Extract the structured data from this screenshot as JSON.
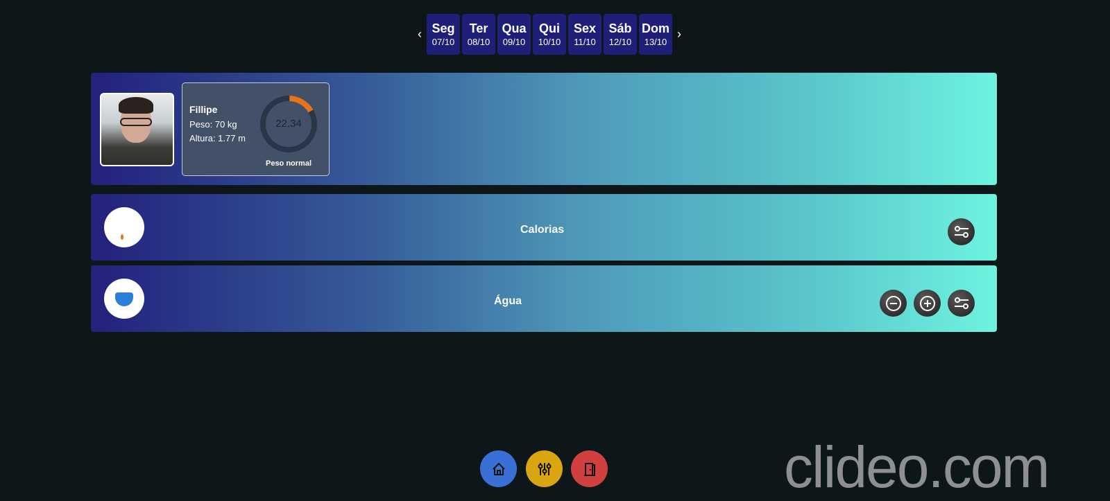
{
  "week": {
    "prev_icon": "chevron-left-icon",
    "next_icon": "chevron-right-icon",
    "days": [
      {
        "name": "Seg",
        "date": "07/10"
      },
      {
        "name": "Ter",
        "date": "08/10"
      },
      {
        "name": "Qua",
        "date": "09/10"
      },
      {
        "name": "Qui",
        "date": "10/10"
      },
      {
        "name": "Sex",
        "date": "11/10"
      },
      {
        "name": "Sáb",
        "date": "12/10"
      },
      {
        "name": "Dom",
        "date": "13/10"
      }
    ]
  },
  "profile": {
    "name": "Fillipe",
    "weight": "Peso: 70 kg",
    "height": "Altura: 1.77 m",
    "bmi": "22,34",
    "bmi_progress": 0.16,
    "bmi_class": "Peso normal",
    "accent": "#e8731a"
  },
  "calories": {
    "title": "Calorias"
  },
  "water": {
    "title": "Água"
  },
  "bottom_nav": [
    {
      "icon": "home-icon",
      "color": "#3a6fd6"
    },
    {
      "icon": "sliders-icon",
      "color": "#d9a511"
    },
    {
      "icon": "door-exit-icon",
      "color": "#d0403f"
    }
  ],
  "watermark": "clideo.com"
}
